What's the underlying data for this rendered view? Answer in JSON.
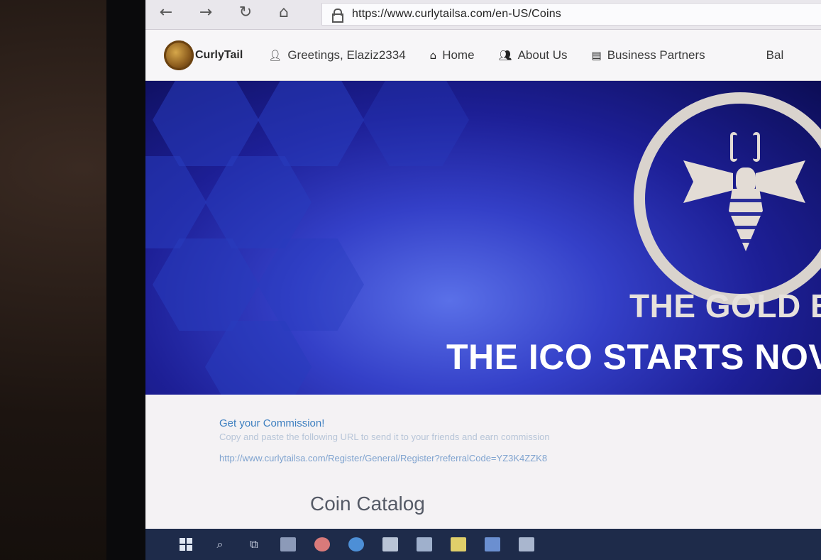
{
  "browser": {
    "back_icon": "back-arrow-icon",
    "forward_icon": "forward-arrow-icon",
    "refresh_icon": "refresh-icon",
    "home_icon": "home-icon",
    "url": "https://www.curlytailsa.com/en-US/Coins"
  },
  "site_nav": {
    "brand": "CurlyTail",
    "greeting": "Greetings, Elaziz2334",
    "items": [
      {
        "label": "Home",
        "icon": "home-icon"
      },
      {
        "label": "About Us",
        "icon": "users-icon"
      },
      {
        "label": "Business Partners",
        "icon": "id-card-icon"
      },
      {
        "label": "Bal",
        "icon": ""
      }
    ]
  },
  "hero": {
    "title": "THE GOLD B",
    "subtitle": "THE ICO STARTS NOV",
    "emblem_icon": "bee-emblem-icon",
    "colors": {
      "deep": "#0c0d55",
      "mid": "#1d1f96",
      "light": "#5a70e8",
      "text": "#e6e1dc"
    }
  },
  "commission": {
    "title": "Get your Commission!",
    "description": "Copy and paste the following URL to send it to your friends and earn commission",
    "link": "http://www.curlytailsa.com/Register/General/Register?referralCode=YZ3K4ZZK8"
  },
  "catalog": {
    "title": "Coin Catalog"
  },
  "taskbar": {
    "icons": [
      "windows-start-icon",
      "search-icon",
      "task-view-icon",
      "file-explorer-icon",
      "chrome-icon",
      "edge-icon",
      "store-icon",
      "mail-icon",
      "sticky-notes-icon",
      "word-icon",
      "photos-icon"
    ]
  }
}
